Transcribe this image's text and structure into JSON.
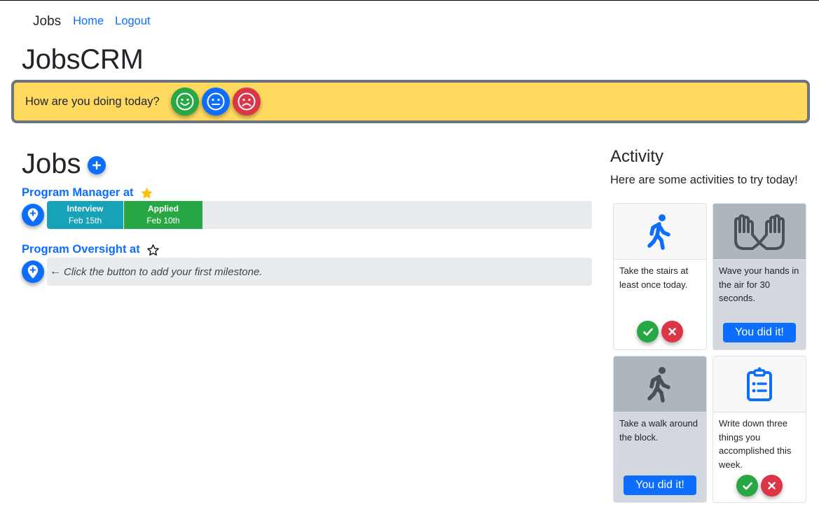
{
  "navbar": {
    "brand": "Jobs",
    "links": [
      {
        "label": "Home"
      },
      {
        "label": "Logout"
      }
    ]
  },
  "app_title": "JobsCRM",
  "mood": {
    "question": "How are you doing today?",
    "options": [
      {
        "name": "happy",
        "color": "#28a745"
      },
      {
        "name": "neutral",
        "color": "#0d6efd"
      },
      {
        "name": "sad",
        "color": "#dc3545"
      }
    ]
  },
  "jobs": {
    "heading": "Jobs",
    "items": [
      {
        "title": "Program Manager at",
        "starred": true,
        "milestones": [
          {
            "label": "Interview",
            "date": "Feb 15th",
            "color": "#17a2b8"
          },
          {
            "label": "Applied",
            "date": "Feb 10th",
            "color": "#28a745"
          }
        ]
      },
      {
        "title": "Program Oversight at",
        "starred": false,
        "milestones": [],
        "hint": "Click the button to add your first milestone."
      }
    ]
  },
  "activity": {
    "heading": "Activity",
    "subtitle": "Here are some activities to try today!",
    "cards": [
      {
        "icon": "walking-icon",
        "text": "Take the stairs at least once today.",
        "completed": false
      },
      {
        "icon": "hands-icon",
        "text": "Wave your hands in the air for 30 seconds.",
        "completed": true,
        "done_label": "You did it!"
      },
      {
        "icon": "walking-icon",
        "text": "Take a walk around the block.",
        "completed": true,
        "done_label": "You did it!"
      },
      {
        "icon": "clipboard-list-icon",
        "text": "Write down three things you accomplished this week.",
        "completed": false
      }
    ]
  }
}
